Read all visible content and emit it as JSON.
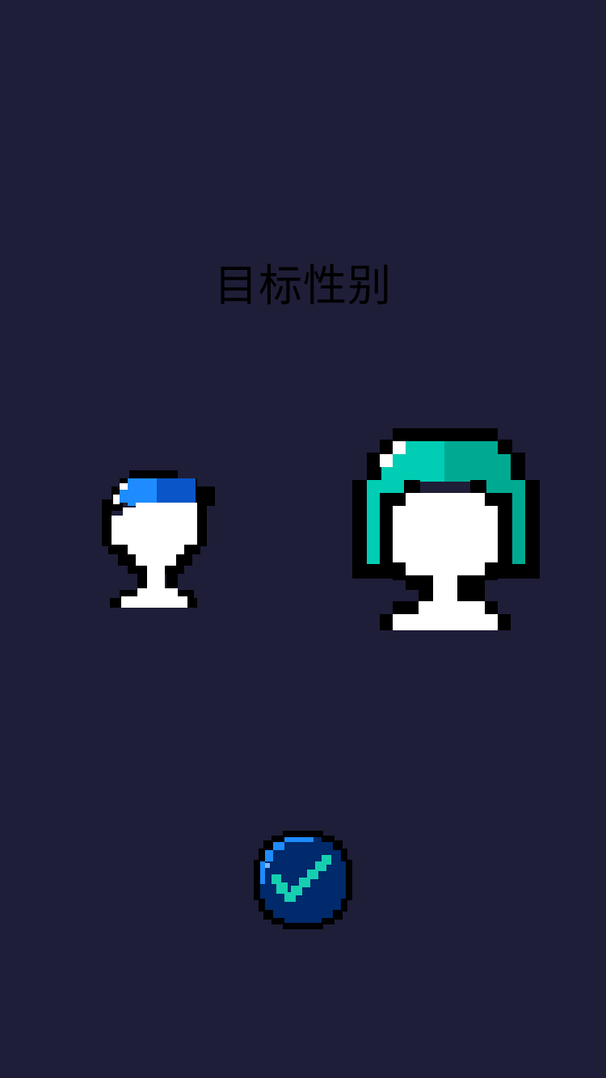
{
  "screen": {
    "title": "目标性别",
    "background_color": "#1e1e38"
  },
  "options": [
    {
      "id": "male",
      "icon": "male-avatar-icon",
      "hair_color": "#1e8cff",
      "hair_shade_color": "#0a55c8"
    },
    {
      "id": "female",
      "icon": "female-avatar-icon",
      "hair_color": "#00cdb4",
      "hair_shade_color": "#00aa92"
    }
  ],
  "confirm_button": {
    "icon": "checkmark-icon",
    "fill_color": "#002a6b",
    "check_color": "#16cfb1"
  }
}
